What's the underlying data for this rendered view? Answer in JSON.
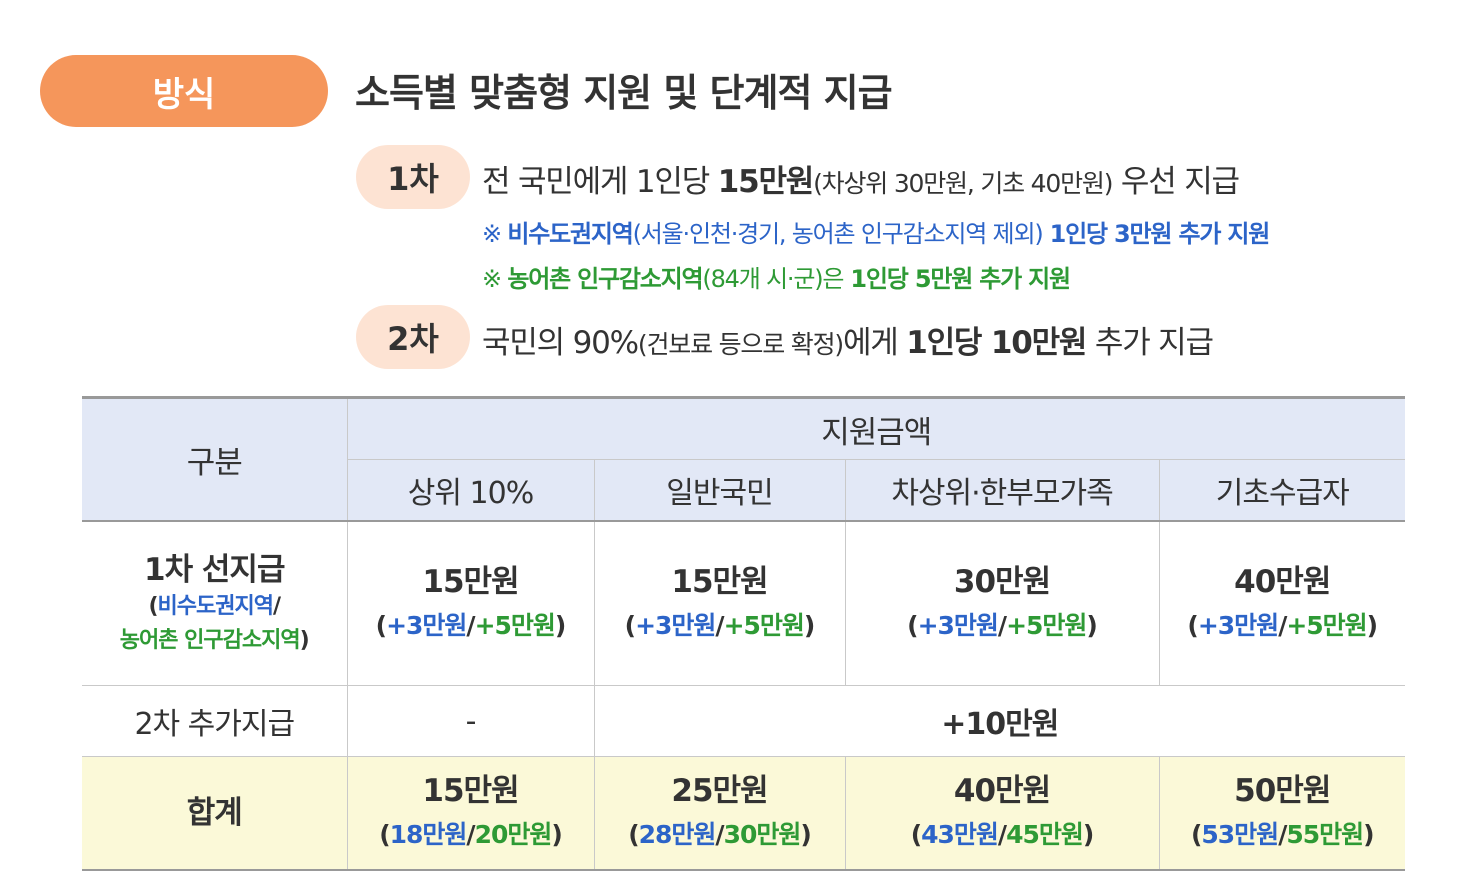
{
  "badge": "방식",
  "heading": "소득별 맞춤형 지원 및 단계적 지급",
  "steps": [
    {
      "label": "1차",
      "pre": "전 국민에게 1인당 ",
      "bold": "15만원",
      "paren": "(차상위 30만원, 기초 40만원)",
      "post": " 우선 지급"
    },
    {
      "label": "2차",
      "pre": "국민의 90%",
      "paren": "(건보료 등으로 확정)",
      "mid": "에게 ",
      "bold": "1인당 10만원",
      "post": " 추가 지급"
    }
  ],
  "notes": [
    {
      "mark": "※ ",
      "bold1": "비수도권지역",
      "paren": "(서울·인천·경기, 농어촌 인구감소지역 제외)",
      "bold2": " 1인당 3만원 추가 지원"
    },
    {
      "mark": "※ ",
      "bold1": "농어촌 인구감소지역",
      "paren": "(84개 시·군)은",
      "bold2": " 1인당 5만원 추가 지원"
    }
  ],
  "table": {
    "row_header": "구분",
    "group_header": "지원금액",
    "columns": [
      "상위 10%",
      "일반국민",
      "차상위·한부모가족",
      "기초수급자"
    ],
    "row1": {
      "label": "1차 선지급",
      "sub_open": "(",
      "sub_blue": "비수도권지역",
      "sub_slash": "/",
      "sub_green": "농어촌 인구감소지역",
      "sub_close": ")",
      "cells": [
        {
          "main": "15만원",
          "open": "(",
          "blue": "+3만원",
          "slash": "/",
          "green": "+5만원",
          "close": ")"
        },
        {
          "main": "15만원",
          "open": "(",
          "blue": "+3만원",
          "slash": "/",
          "green": "+5만원",
          "close": ")"
        },
        {
          "main": "30만원",
          "open": "(",
          "blue": "+3만원",
          "slash": "/",
          "green": "+5만원",
          "close": ")"
        },
        {
          "main": "40만원",
          "open": "(",
          "blue": "+3만원",
          "slash": "/",
          "green": "+5만원",
          "close": ")"
        }
      ]
    },
    "row2": {
      "label": "2차 추가지급",
      "first": "-",
      "merged": "+10만원"
    },
    "row3": {
      "label": "합계",
      "cells": [
        {
          "main": "15만원",
          "open": "(",
          "blue": "18만원",
          "slash": "/",
          "green": "20만원",
          "close": ")"
        },
        {
          "main": "25만원",
          "open": "(",
          "blue": "28만원",
          "slash": "/",
          "green": "30만원",
          "close": ")"
        },
        {
          "main": "40만원",
          "open": "(",
          "blue": "43만원",
          "slash": "/",
          "green": "45만원",
          "close": ")"
        },
        {
          "main": "50만원",
          "open": "(",
          "blue": "53만원",
          "slash": "/",
          "green": "55만원",
          "close": ")"
        }
      ]
    }
  },
  "colors": {
    "badge": "#f5965b",
    "step_badge": "#fde3d3",
    "header_bg": "#e2e8f6",
    "total_bg": "#fbf9d8",
    "blue": "#2c64c8",
    "green": "#2e9a35"
  }
}
